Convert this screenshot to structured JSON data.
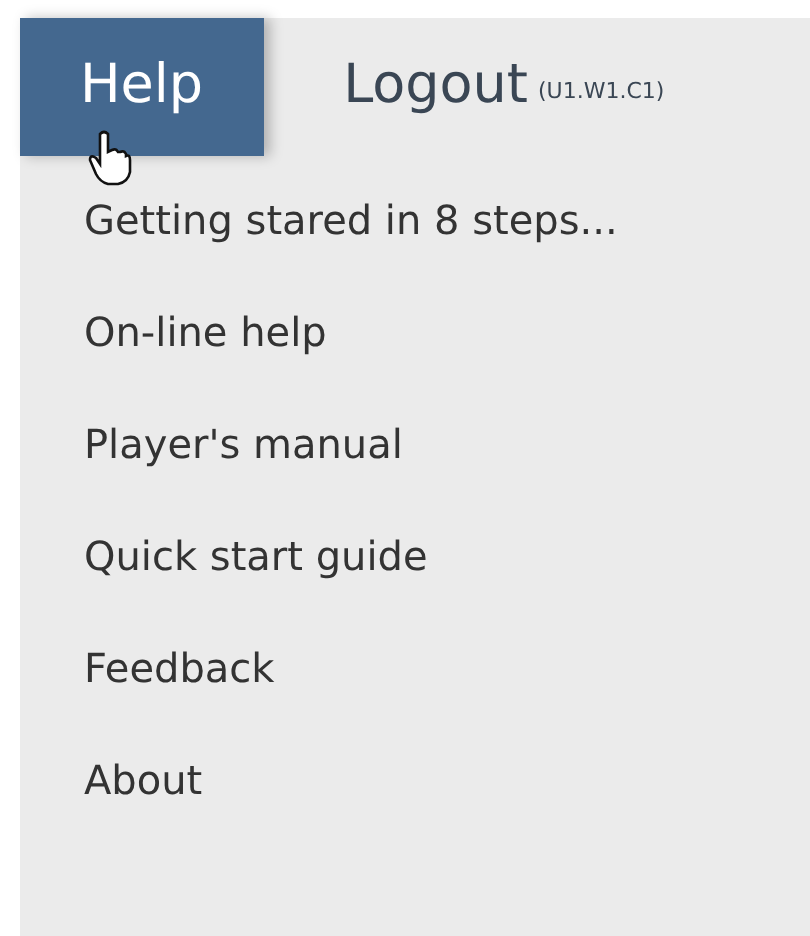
{
  "menu_bar": [
    {
      "label": "Help",
      "selected": true
    },
    {
      "label": "Logout",
      "note": "(U1.W1.C1)",
      "selected": false
    }
  ],
  "dropdown": {
    "items": [
      {
        "label": "Getting stared in 8 steps..."
      },
      {
        "label": "On-line help"
      },
      {
        "label": "Player's manual"
      },
      {
        "label": "Quick start guide"
      },
      {
        "label": "Feedback"
      },
      {
        "label": "About"
      }
    ]
  }
}
